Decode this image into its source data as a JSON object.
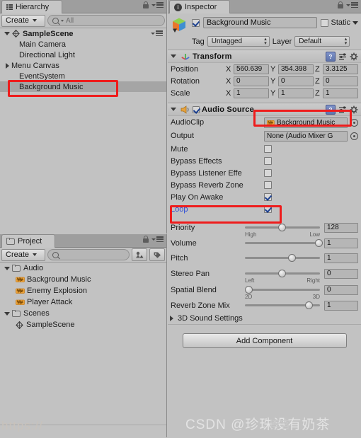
{
  "hierarchy": {
    "tab_label": "Hierarchy",
    "create_label": "Create",
    "search_placeholder": "All",
    "scene_name": "SampleScene",
    "items": [
      {
        "label": "Main Camera",
        "expandable": false,
        "selected": false
      },
      {
        "label": "Directional Light",
        "expandable": false,
        "selected": false
      },
      {
        "label": "Menu Canvas",
        "expandable": true,
        "selected": false
      },
      {
        "label": "EventSystem",
        "expandable": false,
        "selected": false
      },
      {
        "label": "Background Music",
        "expandable": false,
        "selected": true
      }
    ]
  },
  "project": {
    "tab_label": "Project",
    "create_label": "Create",
    "search_placeholder": "",
    "items": [
      {
        "label": "Audio",
        "type": "folder",
        "depth": 0,
        "expanded": true
      },
      {
        "label": "Background Music",
        "type": "audio",
        "depth": 1
      },
      {
        "label": "Enemy Explosion",
        "type": "audio",
        "depth": 1
      },
      {
        "label": "Player Attack",
        "type": "audio",
        "depth": 1
      },
      {
        "label": "Scenes",
        "type": "folder",
        "depth": 0,
        "expanded": true
      },
      {
        "label": "SampleScene",
        "type": "unity",
        "depth": 1
      }
    ]
  },
  "inspector": {
    "tab_label": "Inspector",
    "gameobject": {
      "enabled": true,
      "name": "Background Music",
      "static_label": "Static",
      "static_checked": false,
      "tag_label": "Tag",
      "tag_value": "Untagged",
      "layer_label": "Layer",
      "layer_value": "Default"
    },
    "transform": {
      "title": "Transform",
      "expanded": true,
      "rows": [
        {
          "label": "Position",
          "x": "560.639",
          "y": "354.398",
          "z": "3.3125"
        },
        {
          "label": "Rotation",
          "x": "0",
          "y": "0",
          "z": "0"
        },
        {
          "label": "Scale",
          "x": "1",
          "y": "1",
          "z": "1"
        }
      ]
    },
    "audio_source": {
      "title": "Audio Source",
      "enabled": true,
      "expanded": true,
      "clip_label": "AudioClip",
      "clip_value": "Background Music",
      "output_label": "Output",
      "output_value": "None (Audio Mixer G",
      "toggles": [
        {
          "label": "Mute",
          "checked": false,
          "highlighted": false
        },
        {
          "label": "Bypass Effects",
          "checked": false,
          "highlighted": false
        },
        {
          "label": "Bypass Listener Effe",
          "checked": false,
          "highlighted": false
        },
        {
          "label": "Bypass Reverb Zone",
          "checked": false,
          "highlighted": false
        },
        {
          "label": "Play On Awake",
          "checked": true,
          "highlighted": false
        },
        {
          "label": "Loop",
          "checked": true,
          "highlighted": true
        }
      ],
      "sliders": [
        {
          "label": "Priority",
          "value": "128",
          "pos": 0.5,
          "left": "High",
          "right": "Low"
        },
        {
          "label": "Volume",
          "value": "1",
          "pos": 1.0,
          "left": "",
          "right": ""
        },
        {
          "label": "Pitch",
          "value": "1",
          "pos": 0.64,
          "left": "",
          "right": ""
        },
        {
          "label": "Stereo Pan",
          "value": "0",
          "pos": 0.5,
          "left": "Left",
          "right": "Right"
        },
        {
          "label": "Spatial Blend",
          "value": "0",
          "pos": 0.0,
          "left": "2D",
          "right": "3D"
        },
        {
          "label": "Reverb Zone Mix",
          "value": "1",
          "pos": 0.85,
          "left": "",
          "right": ""
        }
      ],
      "sound_settings_label": "3D Sound Settings"
    },
    "add_component_label": "Add Component"
  },
  "watermark": {
    "url": "https://",
    "csdn": "CSDN @珍珠没有奶茶",
    "blog": "博客"
  },
  "colors": {
    "panel_bg": "#c2c2c2",
    "tab_bar": "#9e9e9e",
    "selection": "#a5a5a5",
    "highlight_red": "#ee1c1c",
    "link_blue": "#2b4cd8"
  }
}
